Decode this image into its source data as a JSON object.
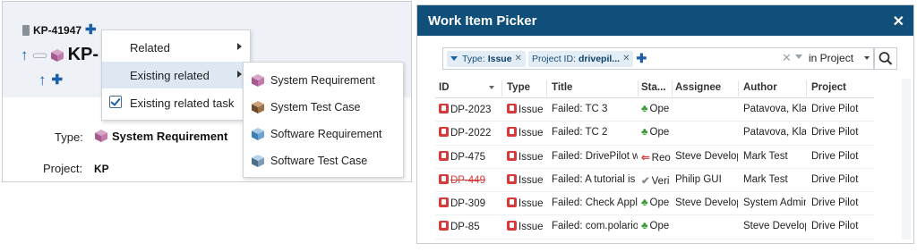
{
  "left": {
    "work_item_id": "KP-41947",
    "title_prefix": "KP-",
    "fields": {
      "type_label": "Type:",
      "type_value": "System Requirement",
      "project_label": "Project:",
      "project_value": "KP"
    },
    "context_menu": {
      "items": [
        {
          "label": "Related"
        },
        {
          "label": "Existing related"
        },
        {
          "label": "Existing related task"
        }
      ]
    },
    "submenu": {
      "items": [
        {
          "label": "System Requirement"
        },
        {
          "label": "System Test Case"
        },
        {
          "label": "Software Requirement"
        },
        {
          "label": "Software Test Case"
        }
      ]
    }
  },
  "picker": {
    "title": "Work Item Picker",
    "query": {
      "chip1_key": "Type: ",
      "chip1_value": "Issue",
      "chip2_key": "Project ID: ",
      "chip2_value": "drivepil...",
      "scope": "in Project"
    },
    "columns": [
      "ID",
      "Type",
      "Title",
      "Sta...",
      "Assignee",
      "Author",
      "Project"
    ],
    "rows": [
      {
        "id": "DP-2023",
        "type": "Issue",
        "title": "Failed: TC 3",
        "status": "Ope",
        "status_kind": "open",
        "assignee": "",
        "author": "Patavova, Klara",
        "project": "Drive Pilot",
        "resolved": false
      },
      {
        "id": "DP-2022",
        "type": "Issue",
        "title": "Failed: TC 2",
        "status": "Ope",
        "status_kind": "open",
        "assignee": "",
        "author": "Patavova, Klara",
        "project": "Drive Pilot",
        "resolved": false
      },
      {
        "id": "DP-475",
        "type": "Issue",
        "title": "Failed: DrivePilot wil",
        "status": "Reo",
        "status_kind": "reopen",
        "assignee": "Steve Develope",
        "author": "Mark Test",
        "project": "Drive Pilot",
        "resolved": false
      },
      {
        "id": "DP-449",
        "type": "Issue",
        "title": "Failed: A tutorial  is r",
        "status": "Veri",
        "status_kind": "verified",
        "assignee": "Philip GUI",
        "author": "Mark Test",
        "project": "Drive Pilot",
        "resolved": true
      },
      {
        "id": "DP-309",
        "type": "Issue",
        "title": "Failed: Check Applic:",
        "status": "Ope",
        "status_kind": "open",
        "assignee": "Steve Develope",
        "author": "System Admini:",
        "project": "Drive Pilot",
        "resolved": false
      },
      {
        "id": "DP-85",
        "type": "Issue",
        "title": "Failed: com.polarion",
        "status": "Ope",
        "status_kind": "open",
        "assignee": "",
        "author": "Steve Develope",
        "project": "Drive Pilot",
        "resolved": false
      }
    ]
  },
  "colors": {
    "titlebar": "#0f4f7a",
    "accent": "#1a5fa8",
    "issue_red": "#d63a3a",
    "open_green": "#3a9a3a"
  }
}
